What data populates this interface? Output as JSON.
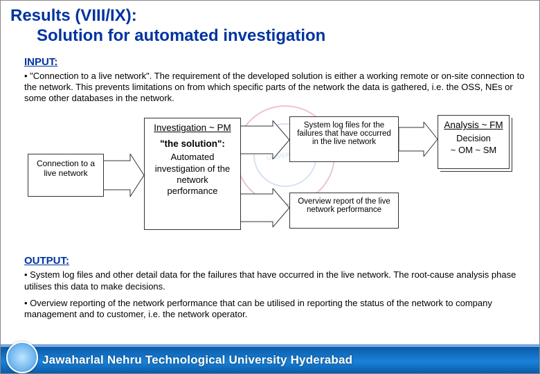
{
  "title": {
    "line1": "Results (VIII/IX):",
    "line2": "Solution for automated investigation"
  },
  "sections": {
    "input_heading": "INPUT:",
    "input_bullet": "• \"Connection to a live network\". The requirement of the developed solution is either a working remote or on-site connection to the network. This prevents limitations on from which specific parts of the network the data is gathered, i.e. the OSS, NEs or some other databases in the network.",
    "output_heading": "OUTPUT:",
    "output_bullet1": "• System log files and other detail data for the failures that have occurred in the live network. The root-cause analysis phase utilises this data to make decisions.",
    "output_bullet2": "• Overview reporting of the network performance that can be utilised in reporting the status of the network to company management and to customer, i.e. the network operator."
  },
  "diagram": {
    "left_box": {
      "text": "Connection to a live network"
    },
    "solution_box": {
      "heading": "Investigation ~ PM",
      "quote": "\"the solution\":",
      "body": "Automated investigation of the network performance"
    },
    "out_top": {
      "text": "System log files for the failures that have occurred in the live network"
    },
    "out_bottom": {
      "text": "Overview report of the live network performance"
    },
    "right_box": {
      "heading": "Analysis ~ FM",
      "line1": "Decision",
      "line2": "~ OM ~ SM"
    }
  },
  "footer": {
    "text": "Jawaharlal Nehru Technological University Hyderabad"
  }
}
